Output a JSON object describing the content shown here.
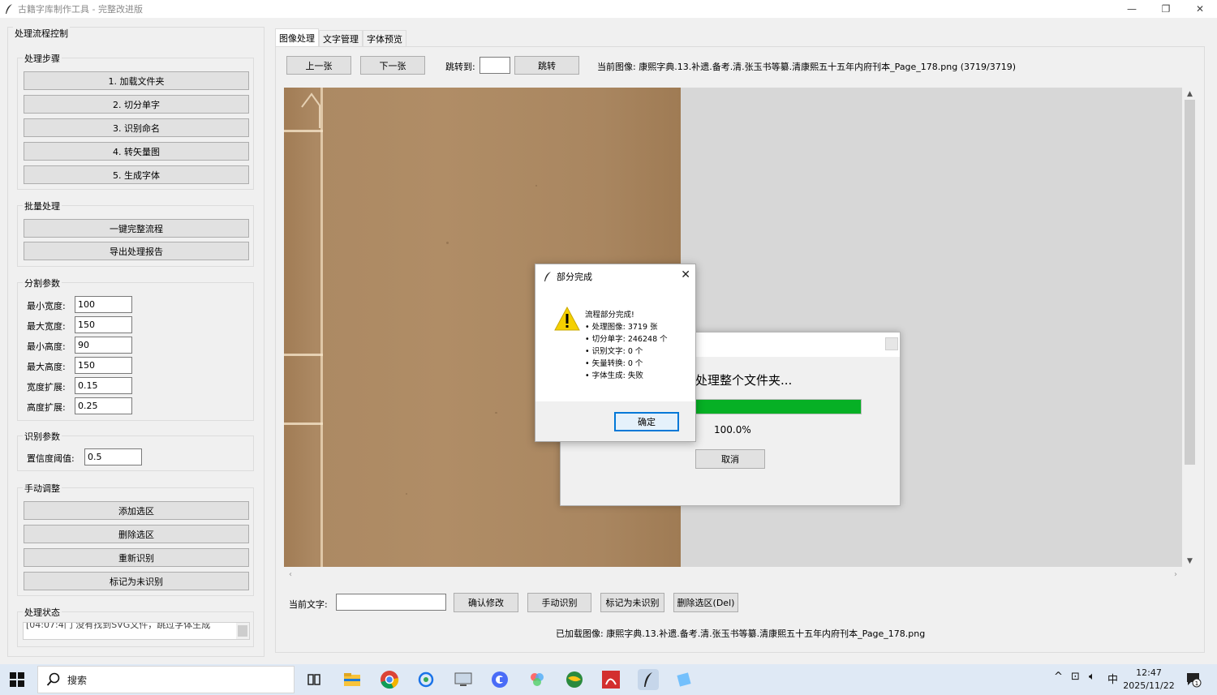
{
  "window": {
    "title": "古籍字库制作工具 - 完整改进版",
    "minimize": "—",
    "restore": "❐",
    "close": "✕"
  },
  "left": {
    "panel_title": "处理流程控制",
    "steps": {
      "legend": "处理步骤",
      "buttons": [
        "1. 加载文件夹",
        "2. 切分单字",
        "3. 识别命名",
        "4. 转矢量图",
        "5. 生成字体"
      ]
    },
    "batch": {
      "legend": "批量处理",
      "buttons": [
        "一键完整流程",
        "导出处理报告"
      ]
    },
    "seg": {
      "legend": "分割参数",
      "params": [
        {
          "label": "最小宽度:",
          "value": "100"
        },
        {
          "label": "最大宽度:",
          "value": "150"
        },
        {
          "label": "最小高度:",
          "value": "90"
        },
        {
          "label": "最大高度:",
          "value": "150"
        },
        {
          "label": "宽度扩展:",
          "value": "0.15"
        },
        {
          "label": "高度扩展:",
          "value": "0.25"
        }
      ]
    },
    "recog": {
      "legend": "识别参数",
      "label": "置信度阈值:",
      "value": "0.5"
    },
    "manual": {
      "legend": "手动调整",
      "buttons": [
        "添加选区",
        "删除选区",
        "重新识别",
        "标记为未识别"
      ]
    },
    "status": {
      "legend": "处理状态",
      "text": "[04:07:4门  没有找到SVG文件，跳过字体生成"
    }
  },
  "tabs": [
    "图像处理",
    "文字管理",
    "字体预览"
  ],
  "image_nav": {
    "prev": "上一张",
    "next": "下一张",
    "jump_label": "跳转到:",
    "jump_value": "",
    "jump_button": "跳转",
    "current_image": "当前图像: 康熙字典.13.补遗.备考.清.张玉书等纂.清康熙五十五年内府刊本_Page_178.png (3719/3719)"
  },
  "edit_bar": {
    "label": "当前文字:",
    "value": "",
    "buttons": [
      "确认修改",
      "手动识别",
      "标记为未识别",
      "删除选区(Del)"
    ]
  },
  "loaded_image": "已加载图像: 康熙字典.13.补遗.备考.清.张玉书等纂.清康熙五十五年内府刊本_Page_178.png",
  "progress": {
    "label": "处理整个文件夹...",
    "fraction": 1.0,
    "percent_text": "100.0%",
    "cancel": "取消"
  },
  "dialog": {
    "title": "部分完成",
    "close": "✕",
    "lines": [
      "流程部分完成!",
      "• 处理图像: 3719 张",
      "• 切分单字: 246248 个",
      "• 识别文字: 0 个",
      "• 矢量转换: 0 个",
      "• 字体生成: 失败"
    ],
    "ok": "确定"
  },
  "taskbar": {
    "search": "搜索",
    "ime": "中",
    "time": "12:47",
    "date": "2025/11/22",
    "notif_count": "1"
  },
  "colors": {
    "progress_green": "#06b025",
    "accent": "#0078d7",
    "warning": "#f5d000"
  }
}
